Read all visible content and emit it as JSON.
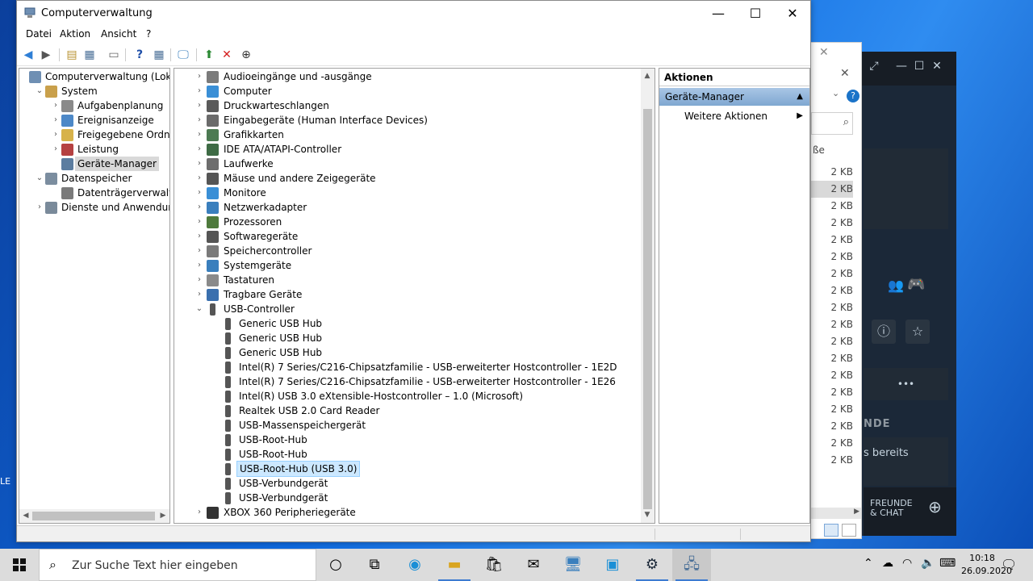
{
  "window": {
    "title": "Computerverwaltung",
    "controls": {
      "minimize": "—",
      "maximize": "☐",
      "close": "✕"
    }
  },
  "menu": [
    "Datei",
    "Aktion",
    "Ansicht",
    "?"
  ],
  "tree": [
    {
      "label": "Computerverwaltung (Lokal)",
      "level": 0,
      "chevron": "",
      "icon": "computer-mgmt-icon",
      "color": "#6f8fb3"
    },
    {
      "label": "System",
      "level": 1,
      "chevron": "⌄",
      "icon": "system-tools-icon",
      "color": "#c9a04b"
    },
    {
      "label": "Aufgabenplanung",
      "level": 2,
      "chevron": "›",
      "icon": "clock-icon",
      "color": "#8a8a8a"
    },
    {
      "label": "Ereignisanzeige",
      "level": 2,
      "chevron": "›",
      "icon": "event-viewer-icon",
      "color": "#4d88c7"
    },
    {
      "label": "Freigegebene Ordner",
      "level": 2,
      "chevron": "›",
      "icon": "shared-folder-icon",
      "color": "#d7b24a"
    },
    {
      "label": "Leistung",
      "level": 2,
      "chevron": "›",
      "icon": "performance-icon",
      "color": "#b54141"
    },
    {
      "label": "Geräte-Manager",
      "level": 2,
      "chevron": "",
      "icon": "device-manager-icon",
      "color": "#5c7da0",
      "selected": true
    },
    {
      "label": "Datenspeicher",
      "level": 1,
      "chevron": "⌄",
      "icon": "storage-icon",
      "color": "#7b8d9f"
    },
    {
      "label": "Datenträgerverwaltung",
      "level": 2,
      "chevron": "",
      "icon": "disk-management-icon",
      "color": "#7a7a7a"
    },
    {
      "label": "Dienste und Anwendungen",
      "level": 1,
      "chevron": "›",
      "icon": "services-icon",
      "color": "#7a8a9a"
    }
  ],
  "devices": [
    {
      "label": "Audioeingänge und -ausgänge",
      "level": 0,
      "chevron": "›",
      "icon": "speaker-icon",
      "color": "#7b7b7b"
    },
    {
      "label": "Computer",
      "level": 0,
      "chevron": "›",
      "icon": "computer-icon",
      "color": "#3a8fd6"
    },
    {
      "label": "Druckwarteschlangen",
      "level": 0,
      "chevron": "›",
      "icon": "printer-icon",
      "color": "#5a5a5a"
    },
    {
      "label": "Eingabegeräte (Human Interface Devices)",
      "level": 0,
      "chevron": "›",
      "icon": "hid-icon",
      "color": "#6b6b6b"
    },
    {
      "label": "Grafikkarten",
      "level": 0,
      "chevron": "›",
      "icon": "display-adapter-icon",
      "color": "#4c7a52"
    },
    {
      "label": "IDE ATA/ATAPI-Controller",
      "level": 0,
      "chevron": "›",
      "icon": "ide-controller-icon",
      "color": "#3e6b45"
    },
    {
      "label": "Laufwerke",
      "level": 0,
      "chevron": "›",
      "icon": "drive-icon",
      "color": "#6d6d6d"
    },
    {
      "label": "Mäuse und andere Zeigegeräte",
      "level": 0,
      "chevron": "›",
      "icon": "mouse-icon",
      "color": "#555"
    },
    {
      "label": "Monitore",
      "level": 0,
      "chevron": "›",
      "icon": "monitor-icon",
      "color": "#3a8fd6"
    },
    {
      "label": "Netzwerkadapter",
      "level": 0,
      "chevron": "›",
      "icon": "network-adapter-icon",
      "color": "#3a7fbd"
    },
    {
      "label": "Prozessoren",
      "level": 0,
      "chevron": "›",
      "icon": "processor-icon",
      "color": "#4e7a3c"
    },
    {
      "label": "Softwaregeräte",
      "level": 0,
      "chevron": "›",
      "icon": "software-device-icon",
      "color": "#555"
    },
    {
      "label": "Speichercontroller",
      "level": 0,
      "chevron": "›",
      "icon": "storage-controller-icon",
      "color": "#7a7a7a"
    },
    {
      "label": "Systemgeräte",
      "level": 0,
      "chevron": "›",
      "icon": "system-device-icon",
      "color": "#3a7fbd"
    },
    {
      "label": "Tastaturen",
      "level": 0,
      "chevron": "›",
      "icon": "keyboard-icon",
      "color": "#8a8a8a"
    },
    {
      "label": "Tragbare Geräte",
      "level": 0,
      "chevron": "›",
      "icon": "portable-device-icon",
      "color": "#3a6fae"
    },
    {
      "label": "USB-Controller",
      "level": 0,
      "chevron": "⌄",
      "icon": "usb-icon",
      "color": "#555"
    },
    {
      "label": "Generic USB Hub",
      "level": 1,
      "chevron": "",
      "icon": "usb-icon",
      "color": "#555"
    },
    {
      "label": "Generic USB Hub",
      "level": 1,
      "chevron": "",
      "icon": "usb-icon",
      "color": "#555"
    },
    {
      "label": "Generic USB Hub",
      "level": 1,
      "chevron": "",
      "icon": "usb-icon",
      "color": "#555"
    },
    {
      "label": "Intel(R) 7 Series/C216-Chipsatzfamilie - USB-erweiterter Hostcontroller - 1E2D",
      "level": 1,
      "chevron": "",
      "icon": "usb-icon",
      "color": "#555"
    },
    {
      "label": "Intel(R) 7 Series/C216-Chipsatzfamilie - USB-erweiterter Hostcontroller - 1E26",
      "level": 1,
      "chevron": "",
      "icon": "usb-icon",
      "color": "#555"
    },
    {
      "label": "Intel(R) USB 3.0 eXtensible-Hostcontroller – 1.0 (Microsoft)",
      "level": 1,
      "chevron": "",
      "icon": "usb-icon",
      "color": "#555"
    },
    {
      "label": "Realtek USB 2.0 Card Reader",
      "level": 1,
      "chevron": "",
      "icon": "usb-icon",
      "color": "#555"
    },
    {
      "label": "USB-Massenspeichergerät",
      "level": 1,
      "chevron": "",
      "icon": "usb-icon",
      "color": "#555"
    },
    {
      "label": "USB-Root-Hub",
      "level": 1,
      "chevron": "",
      "icon": "usb-icon",
      "color": "#555"
    },
    {
      "label": "USB-Root-Hub",
      "level": 1,
      "chevron": "",
      "icon": "usb-icon",
      "color": "#555"
    },
    {
      "label": "USB-Root-Hub (USB 3.0)",
      "level": 1,
      "chevron": "",
      "icon": "usb-icon",
      "color": "#555",
      "selected": true
    },
    {
      "label": "USB-Verbundgerät",
      "level": 1,
      "chevron": "",
      "icon": "usb-icon",
      "color": "#555"
    },
    {
      "label": "USB-Verbundgerät",
      "level": 1,
      "chevron": "",
      "icon": "usb-icon",
      "color": "#555"
    },
    {
      "label": "XBOX 360 Peripheriegeräte",
      "level": 0,
      "chevron": "›",
      "icon": "gamepad-icon",
      "color": "#333"
    }
  ],
  "actions": {
    "header": "Aktionen",
    "section": "Geräte-Manager",
    "more": "Weitere Aktionen"
  },
  "explorer": {
    "partial_header": "ße",
    "sizes": [
      "2 KB",
      "2 KB",
      "2 KB",
      "2 KB",
      "2 KB",
      "2 KB",
      "2 KB",
      "2 KB",
      "2 KB",
      "2 KB",
      "2 KB",
      "2 KB",
      "2 KB",
      "2 KB",
      "2 KB",
      "2 KB",
      "2 KB",
      "2 KB"
    ]
  },
  "steam": {
    "label_partial_1": "NDE",
    "label_partial_2": "s bereits",
    "friends_line1": "FREUNDE",
    "friends_line2": "& CHAT"
  },
  "taskbar": {
    "search_placeholder": "Zur Suche Text hier eingeben",
    "time": "10:18",
    "date": "26.09.2020"
  },
  "desktop": {
    "edge_text": "LE"
  }
}
